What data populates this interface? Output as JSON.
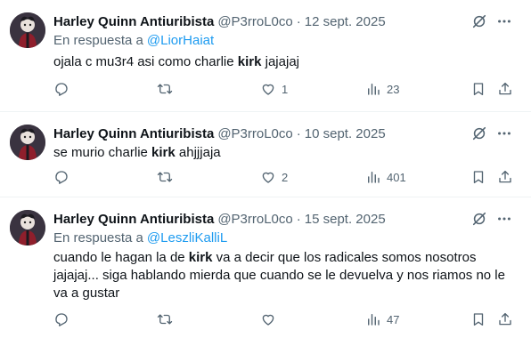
{
  "tweets": [
    {
      "display_name": "Harley Quinn Antiuribista",
      "handle": "@P3rroL0co",
      "separator": "·",
      "date": "12 sept. 2025",
      "reply_prefix": "En respuesta a",
      "reply_to": "@LiorHaiat",
      "text_before": "ojala c mu3r4 asi como charlie ",
      "text_bold": "kirk",
      "text_after": " jajajaj",
      "reply_count": "",
      "retweet_count": "",
      "like_count": "1",
      "view_count": "23"
    },
    {
      "display_name": "Harley Quinn Antiuribista",
      "handle": "@P3rroL0co",
      "separator": "·",
      "date": "10 sept. 2025",
      "text_before": "se murio charlie ",
      "text_bold": "kirk",
      "text_after": " ahjjjaja",
      "reply_count": "",
      "retweet_count": "",
      "like_count": "2",
      "view_count": "401"
    },
    {
      "display_name": "Harley Quinn Antiuribista",
      "handle": "@P3rroL0co",
      "separator": "·",
      "date": "15 sept. 2025",
      "reply_prefix": "En respuesta a",
      "reply_to": "@LeszliKalliL",
      "text_before": "cuando le hagan la de ",
      "text_bold": "kirk",
      "text_after": " va a decir que los radicales somos nosotros jajajaj... siga hablando mierda que cuando se le devuelva y nos riamos no le va a gustar",
      "reply_count": "",
      "retweet_count": "",
      "like_count": "",
      "view_count": "47"
    }
  ],
  "icons": {
    "reply": "reply-icon",
    "retweet": "retweet-icon",
    "like": "heart-icon",
    "views": "views-icon",
    "bookmark": "bookmark-icon",
    "share": "share-icon",
    "grok": "grok-icon",
    "more": "more-icon"
  },
  "colors": {
    "text": "#0f1419",
    "secondary": "#536471",
    "link": "#1d9bf0",
    "divider": "#eff3f4"
  }
}
